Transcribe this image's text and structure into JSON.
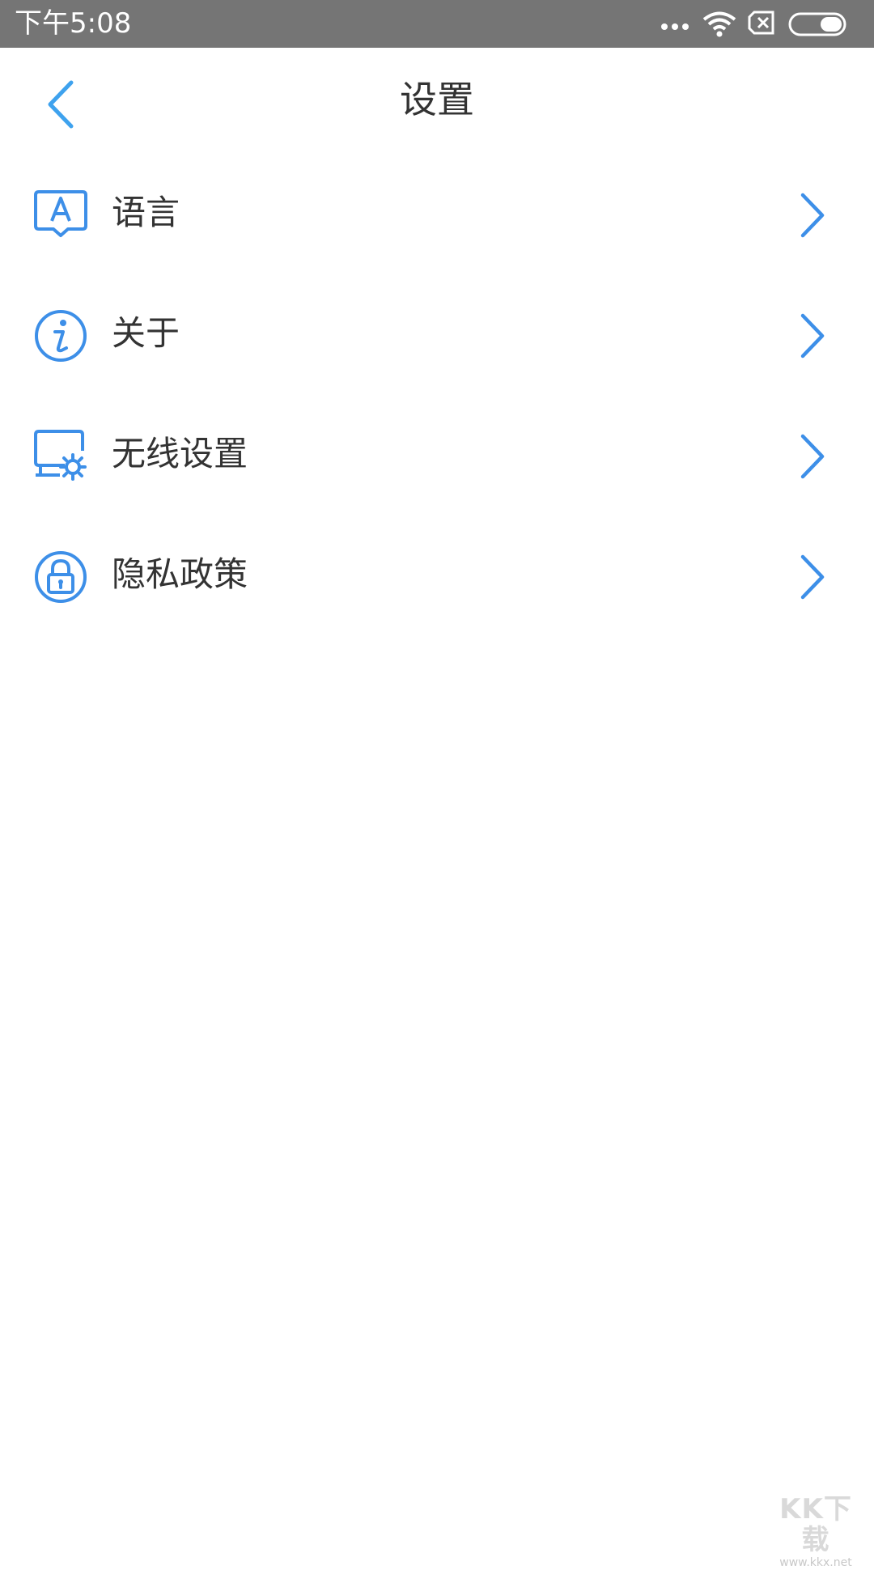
{
  "status_bar": {
    "time": "下午5:08",
    "icons": [
      "more-dots-icon",
      "wifi-icon",
      "no-sim-icon",
      "battery-icon"
    ],
    "background": "#757575"
  },
  "header": {
    "title": "设置",
    "back_icon": "chevron-left-icon"
  },
  "menu": {
    "items": [
      {
        "label": "语言",
        "icon": "language-icon"
      },
      {
        "label": "关于",
        "icon": "info-icon"
      },
      {
        "label": "无线设置",
        "icon": "wireless-settings-icon"
      },
      {
        "label": "隐私政策",
        "icon": "privacy-lock-icon"
      }
    ]
  },
  "watermark": {
    "logo": "KK下载",
    "url": "www.kkx.net"
  },
  "colors": {
    "accent": "#3d8fe8",
    "text": "#333333",
    "background": "#ffffff"
  }
}
